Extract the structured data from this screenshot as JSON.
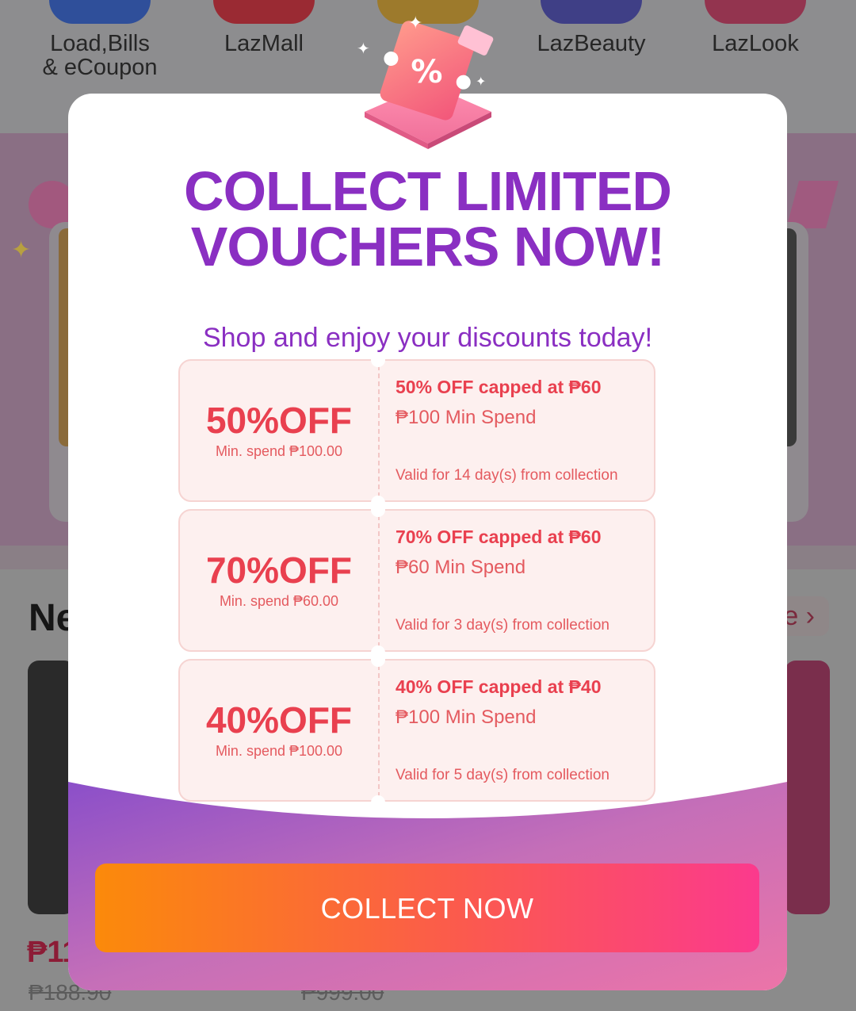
{
  "background": {
    "categories": [
      {
        "label": "Load,Bills\n& eCoupon",
        "color": "#2a58c8"
      },
      {
        "label": "LazMall",
        "color": "#cf2a3a"
      },
      {
        "label": "",
        "color": "#e3a11a"
      },
      {
        "label": "LazBeauty",
        "color": "#4b4bb8"
      },
      {
        "label": "LazLook",
        "color": "#d23a6a"
      }
    ],
    "section_title": "Ne",
    "see_more": "e ›",
    "price": "₱11",
    "old_price_1": "₱188.90",
    "old_price_2": "₱999.00"
  },
  "modal": {
    "title_line1": "COLLECT LIMITED",
    "title_line2": "VOUCHERS NOW!",
    "subtitle": "Shop and enjoy your discounts today!",
    "vouchers": [
      {
        "discount": "50%OFF",
        "min_spend": "Min. spend ₱100.00",
        "headline": "50% OFF capped at ₱60",
        "spend": "₱100 Min Spend",
        "validity": "Valid for 14 day(s) from collection"
      },
      {
        "discount": "70%OFF",
        "min_spend": "Min. spend ₱60.00",
        "headline": "70% OFF capped at ₱60",
        "spend": "₱60 Min Spend",
        "validity": "Valid for 3 day(s) from collection"
      },
      {
        "discount": "40%OFF",
        "min_spend": "Min. spend ₱100.00",
        "headline": "40% OFF capped at ₱40",
        "spend": "₱100 Min Spend",
        "validity": "Valid for 5 day(s) from collection"
      }
    ],
    "cta_label": "COLLECT NOW",
    "colors": {
      "title": "#8a2fc2",
      "voucher_text": "#e9404f",
      "cta_start": "#fb8a0a",
      "cta_end": "#fb3a8d"
    }
  }
}
